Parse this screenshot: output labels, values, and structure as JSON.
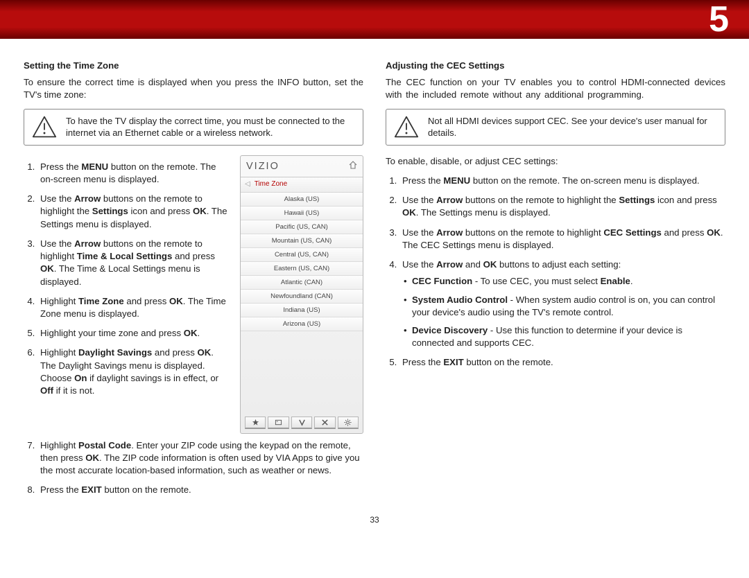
{
  "chapter": "5",
  "page_number": "33",
  "left": {
    "heading": "Setting the Time Zone",
    "intro": "To ensure the correct time is displayed when you press the INFO button, set the TV's time zone:",
    "note": "To have the TV display the correct time, you must be connected to the internet via an Ethernet cable or a wireless network.",
    "steps": {
      "s1a": "Press the ",
      "s1b": "MENU",
      "s1c": " button on the remote. The on-screen menu is displayed.",
      "s2a": "Use the ",
      "s2b": "Arrow",
      "s2c": " buttons on the remote to highlight the ",
      "s2d": "Settings",
      "s2e": " icon and press ",
      "s2f": "OK",
      "s2g": ". The Settings menu is displayed.",
      "s3a": "Use the ",
      "s3b": "Arrow",
      "s3c": " buttons on the remote to highlight ",
      "s3d": "Time & Local Settings",
      "s3e": " and press ",
      "s3f": "OK",
      "s3g": ". The Time & Local Settings menu is displayed.",
      "s4a": "Highlight ",
      "s4b": "Time Zone",
      "s4c": " and press ",
      "s4d": "OK",
      "s4e": ". The Time Zone menu is displayed.",
      "s5a": "Highlight your time zone and press ",
      "s5b": "OK",
      "s5c": ".",
      "s6a": "Highlight ",
      "s6b": "Daylight Savings",
      "s6c": " and press ",
      "s6d": "OK",
      "s6e": ". The Daylight Savings menu is displayed. Choose ",
      "s6f": "On",
      "s6g": " if daylight savings is in effect, or ",
      "s6h": "Off",
      "s6i": " if it is not.",
      "s7a": "Highlight ",
      "s7b": "Postal Code",
      "s7c": ". Enter your ZIP code using the keypad on the remote, then press ",
      "s7d": "OK",
      "s7e": ". The ZIP code information is often used by VIA Apps to give you the most accurate location-based information, such as weather or news.",
      "s8a": "Press the ",
      "s8b": "EXIT",
      "s8c": " button on the remote."
    }
  },
  "right": {
    "heading": "Adjusting the CEC Settings",
    "intro": "The CEC function on your TV enables you to control HDMI-connected devices with the included remote without any additional programming.",
    "note": "Not all HDMI devices support CEC. See your device's user manual for details.",
    "lead": "To enable, disable, or adjust CEC settings:",
    "steps": {
      "s1a": "Press the ",
      "s1b": "MENU",
      "s1c": " button on the remote. The on-screen menu is displayed.",
      "s2a": "Use the ",
      "s2b": "Arrow",
      "s2c": " buttons on the remote to highlight the ",
      "s2d": "Settings",
      "s2e": " icon and press ",
      "s2f": "OK",
      "s2g": ". The Settings menu is displayed.",
      "s3a": "Use the ",
      "s3b": "Arrow",
      "s3c": " buttons on the remote to highlight ",
      "s3d": "CEC Settings",
      "s3e": " and press ",
      "s3f": "OK",
      "s3g": ". The CEC Settings menu is displayed.",
      "s4a": "Use the ",
      "s4b": "Arrow",
      "s4c": " and ",
      "s4d": "OK",
      "s4e": " buttons to adjust each setting:",
      "b1a": "CEC Function",
      "b1b": " - To use CEC, you must select ",
      "b1c": "Enable",
      "b1d": ".",
      "b2a": "System Audio Control",
      "b2b": " - When system audio control is on, you can control your device's audio using the TV's remote control.",
      "b3a": "Device Discovery",
      "b3b": " - Use this function to determine if your device is connected and supports CEC.",
      "s5a": "Press the ",
      "s5b": "EXIT",
      "s5c": " button on the remote."
    }
  },
  "tv": {
    "brand": "VIZIO",
    "menu_title": "Time Zone",
    "items": [
      "Alaska (US)",
      "Hawaii (US)",
      "Pacific (US, CAN)",
      "Mountain (US, CAN)",
      "Central (US, CAN)",
      "Eastern (US, CAN)",
      "Atlantic (CAN)",
      "Newfoundland (CAN)",
      "Indiana (US)",
      "Arizona (US)"
    ]
  }
}
